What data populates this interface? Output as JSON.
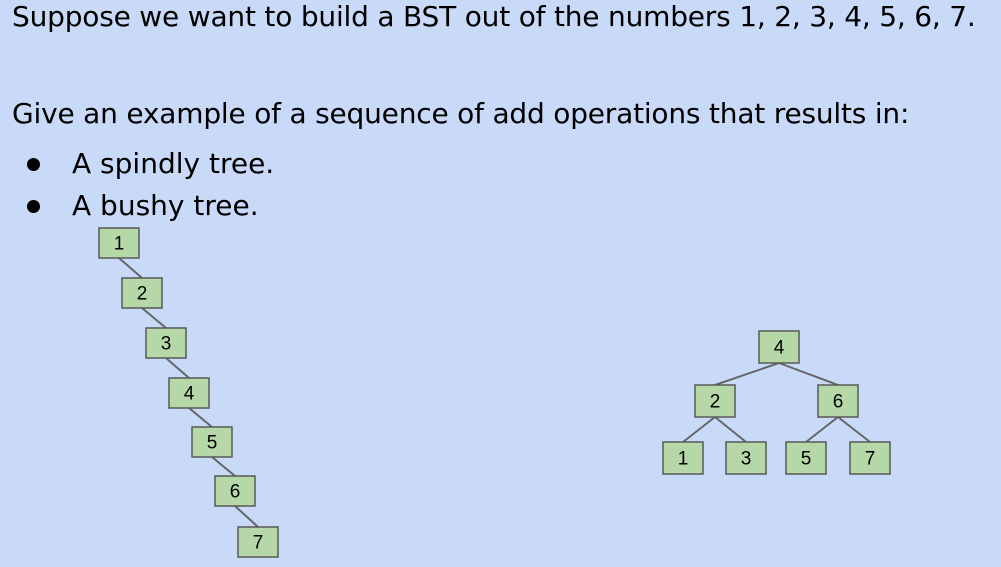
{
  "heading": "Suppose we want to build a BST out of the numbers 1, 2, 3, 4, 5, 6, 7.",
  "prompt": "Give an example of a sequence of add operations that results in:",
  "bullets": [
    "A spindly tree.",
    "A bushy tree."
  ],
  "colors": {
    "background": "#c9daf8",
    "node_fill": "#b6d7a8",
    "node_border": "#595959",
    "edge": "#666666"
  },
  "spindly_tree": {
    "nodes": [
      "1",
      "2",
      "3",
      "4",
      "5",
      "6",
      "7"
    ],
    "edges": [
      [
        "1",
        "2"
      ],
      [
        "2",
        "3"
      ],
      [
        "3",
        "4"
      ],
      [
        "4",
        "5"
      ],
      [
        "5",
        "6"
      ],
      [
        "6",
        "7"
      ]
    ]
  },
  "bushy_tree": {
    "nodes": [
      "4",
      "2",
      "6",
      "1",
      "3",
      "5",
      "7"
    ],
    "edges": [
      [
        "4",
        "2"
      ],
      [
        "4",
        "6"
      ],
      [
        "2",
        "1"
      ],
      [
        "2",
        "3"
      ],
      [
        "6",
        "5"
      ],
      [
        "6",
        "7"
      ]
    ]
  }
}
